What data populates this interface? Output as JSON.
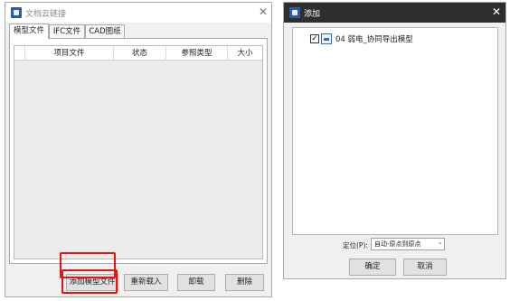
{
  "left_dialog": {
    "title": "文档云链接",
    "tabs": [
      "模型文件",
      "IFC文件",
      "CAD图纸"
    ],
    "table_headers": [
      "项目文件",
      "状态",
      "参照类型",
      "大小"
    ],
    "buttons": {
      "add_model": "添加模型文件",
      "reload": "重新载入",
      "unload": "卸载",
      "delete": "删除"
    }
  },
  "right_dialog": {
    "title": "添加",
    "tree_item": "04 弱电_协同导出模型",
    "tree_item_checked": true,
    "location_label": "定位(P):",
    "location_value": "自动-原点到原点",
    "buttons": {
      "ok": "确定",
      "cancel": "取消"
    }
  },
  "colors": {
    "highlight": "#ee1111",
    "right_titlebar": "#2e2e2e"
  },
  "icons": {
    "app": "app-icon",
    "close": "close-icon",
    "file": "file-icon",
    "dropdown": "chevron-down-icon"
  }
}
